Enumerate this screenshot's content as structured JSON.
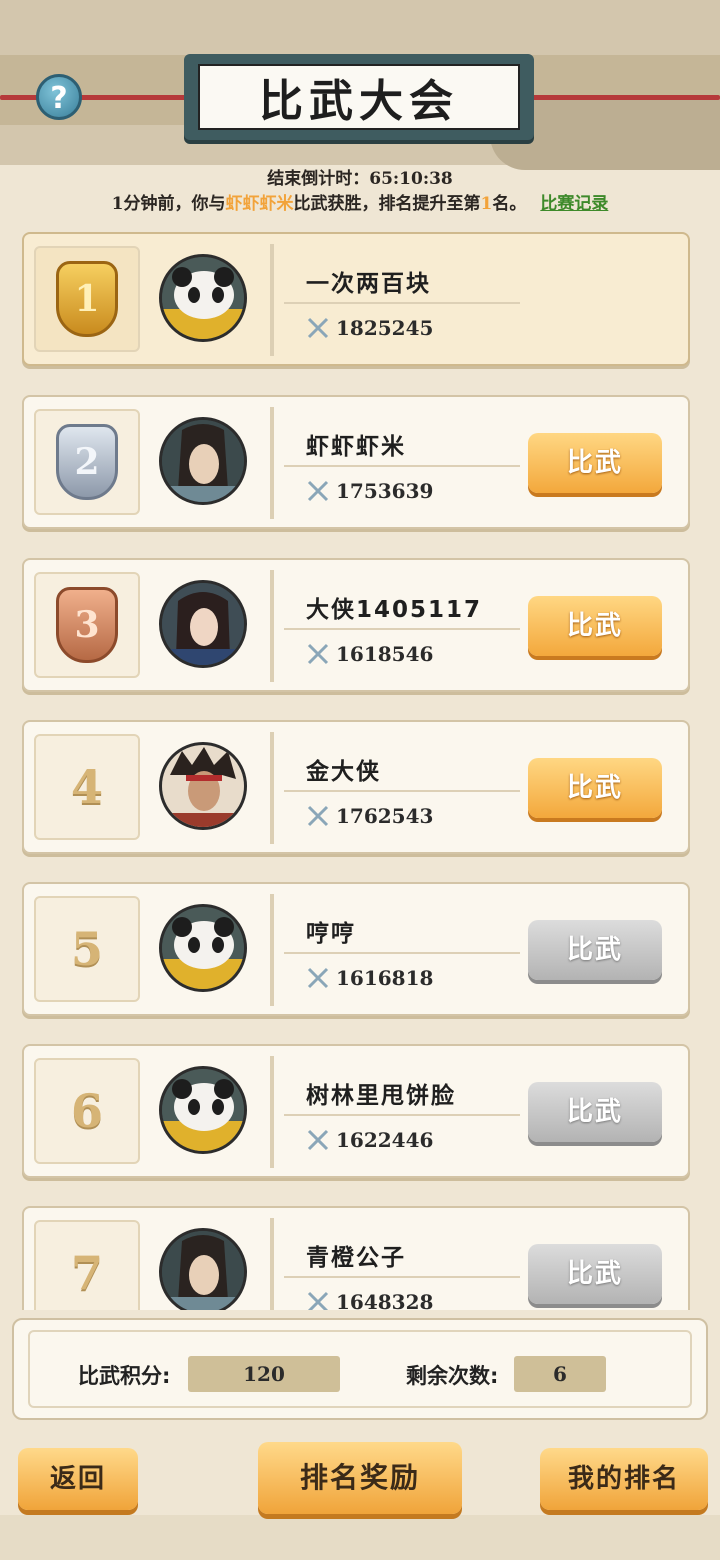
{
  "header": {
    "title": "比武大会",
    "help_icon": "?"
  },
  "countdown": {
    "label": "结束倒计时：",
    "value": "65:10:38"
  },
  "notice": {
    "prefix": "1分钟前，你与",
    "opponent": "虾虾虾米",
    "middle": "比武获胜，排名提升至第",
    "rank": "1",
    "suffix": "名。",
    "record_link": "比赛记录"
  },
  "ranking": [
    {
      "rank": "1",
      "name": "一次两百块",
      "power": "1825245",
      "avatar": "panda",
      "fight_label": "",
      "enabled": false
    },
    {
      "rank": "2",
      "name": "虾虾虾米",
      "power": "1753639",
      "avatar": "swordsman-long-hair",
      "fight_label": "比武",
      "enabled": true
    },
    {
      "rank": "3",
      "name": "大侠1405117",
      "power": "1618546",
      "avatar": "lady-swordsman",
      "fight_label": "比武",
      "enabled": true
    },
    {
      "rank": "4",
      "name": "金大侠",
      "power": "1762543",
      "avatar": "wild-hair-warrior",
      "fight_label": "比武",
      "enabled": true
    },
    {
      "rank": "5",
      "name": "哼哼",
      "power": "1616818",
      "avatar": "panda",
      "fight_label": "比武",
      "enabled": false
    },
    {
      "rank": "6",
      "name": "树林里甩饼脸",
      "power": "1622446",
      "avatar": "panda",
      "fight_label": "比武",
      "enabled": false
    },
    {
      "rank": "7",
      "name": "青橙公子",
      "power": "1648328",
      "avatar": "swordsman-long-hair",
      "fight_label": "比武",
      "enabled": false
    }
  ],
  "score_panel": {
    "points_label": "比武积分:",
    "points_value": "120",
    "remaining_label": "剩余次数:",
    "remaining_value": "6"
  },
  "buttons": {
    "back": "返回",
    "rank_reward": "排名奖励",
    "my_rank": "我的排名"
  },
  "colors": {
    "highlight": "#f2a33a",
    "link": "#3e8a2a",
    "button_orange": "#f3a83c",
    "button_gray": "#b3b3b3"
  }
}
